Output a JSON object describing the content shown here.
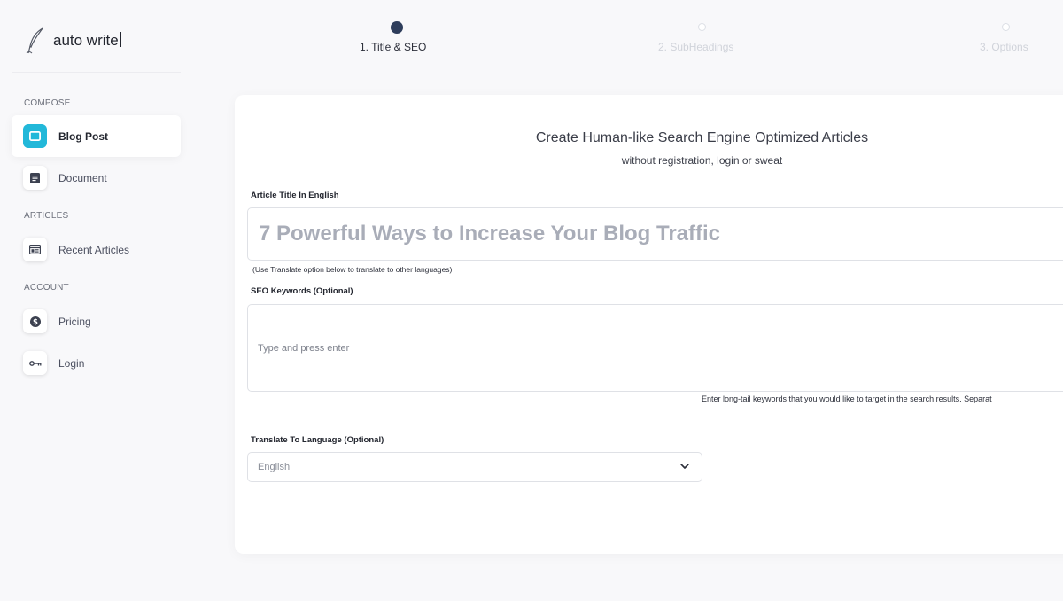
{
  "brand": {
    "name": "auto write",
    "logo_icon": "quill-icon"
  },
  "sidebar": {
    "sections": [
      {
        "label": "COMPOSE"
      },
      {
        "label": "ARTICLES"
      },
      {
        "label": "ACCOUNT"
      }
    ],
    "items": [
      {
        "label": "Blog Post",
        "icon": "monitor-icon",
        "active": true
      },
      {
        "label": "Document",
        "icon": "document-icon",
        "active": false
      },
      {
        "label": "Recent Articles",
        "icon": "browser-window-icon",
        "active": false
      },
      {
        "label": "Pricing",
        "icon": "dollar-circle-icon",
        "active": false
      },
      {
        "label": "Login",
        "icon": "key-icon",
        "active": false
      }
    ]
  },
  "stepper": {
    "steps": [
      {
        "label": "1. Title & SEO",
        "state": "current"
      },
      {
        "label": "2. SubHeadings",
        "state": "future"
      },
      {
        "label": "3. Options",
        "state": "future"
      }
    ]
  },
  "main": {
    "headline": "Create Human-like Search Engine Optimized Articles",
    "subheadline": "without registration, login or sweat",
    "title_field": {
      "label": "Article Title In English",
      "placeholder": "7 Powerful Ways to Increase Your Blog Traffic",
      "value": "",
      "hint": "(Use Translate option below to translate to other languages)"
    },
    "keywords_field": {
      "label": "SEO Keywords (Optional)",
      "placeholder": "Type and press enter",
      "help": "Enter long-tail keywords that you would like to target in the search results. Separat"
    },
    "language_field": {
      "label": "Translate To Language (Optional)",
      "selected": "English"
    }
  },
  "colors": {
    "accent": "#22b8d9",
    "step_active": "#2e3d5b",
    "background": "#f8f8fa"
  }
}
